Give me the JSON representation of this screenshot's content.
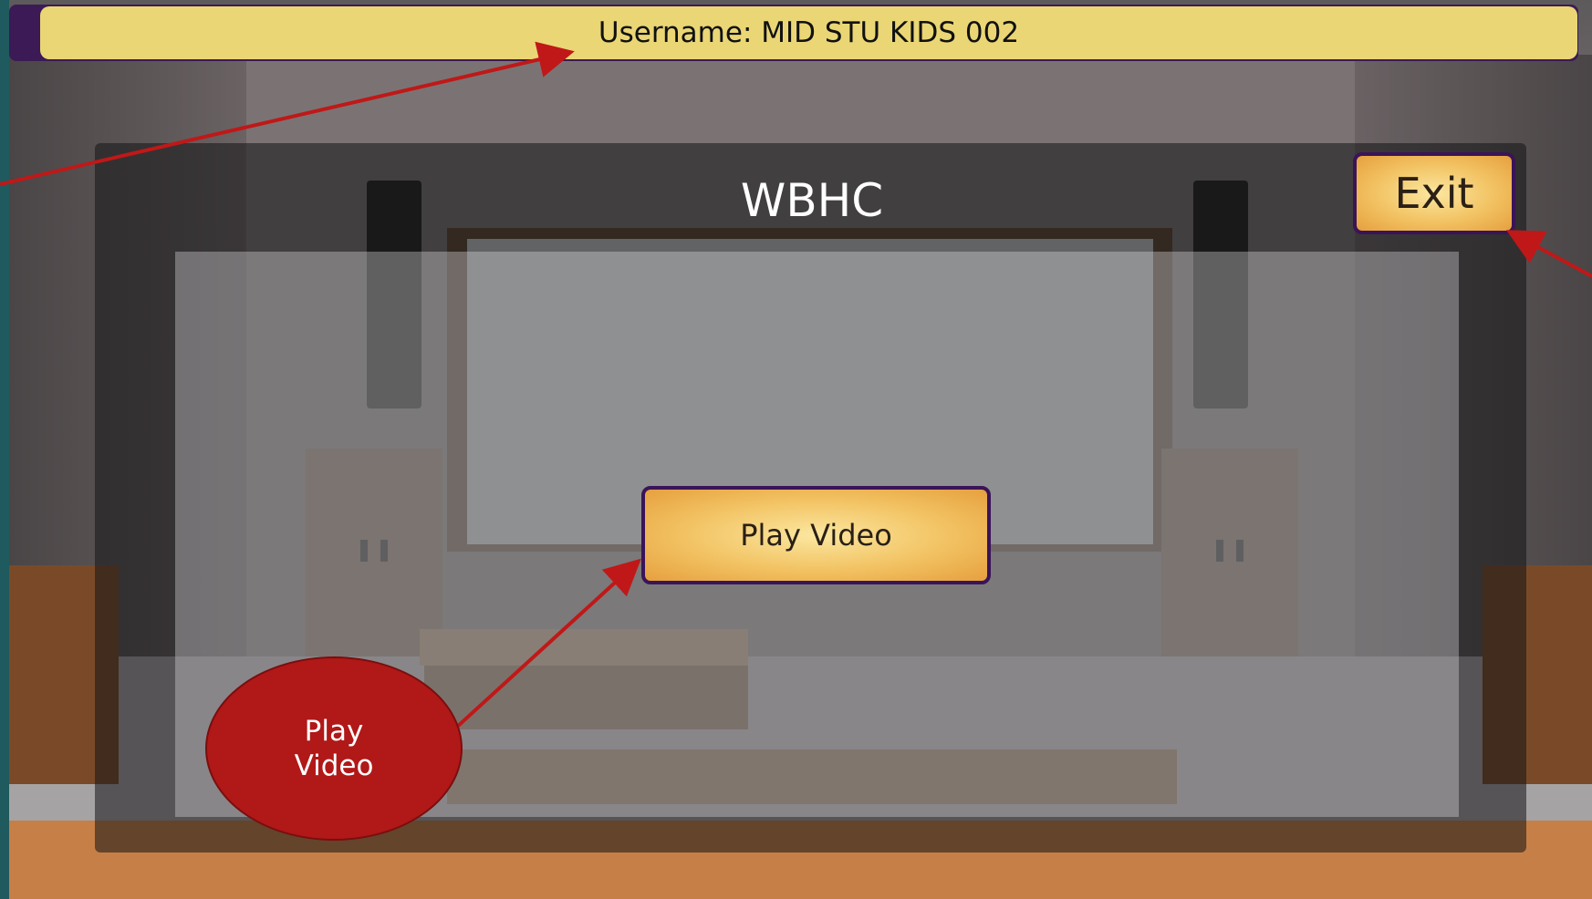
{
  "header": {
    "username_label": "Username: MID STU KIDS 002"
  },
  "dialog": {
    "title": "WBHC",
    "exit_label": "Exit",
    "play_label": "Play Video"
  },
  "annotation": {
    "callout_line1": "Play",
    "callout_line2": "Video"
  },
  "colors": {
    "header_bar": "#ead675",
    "button_gold": "#f2c262",
    "button_border": "#3a1458",
    "callout_red": "#b11818",
    "arrow_red": "#c01818"
  }
}
